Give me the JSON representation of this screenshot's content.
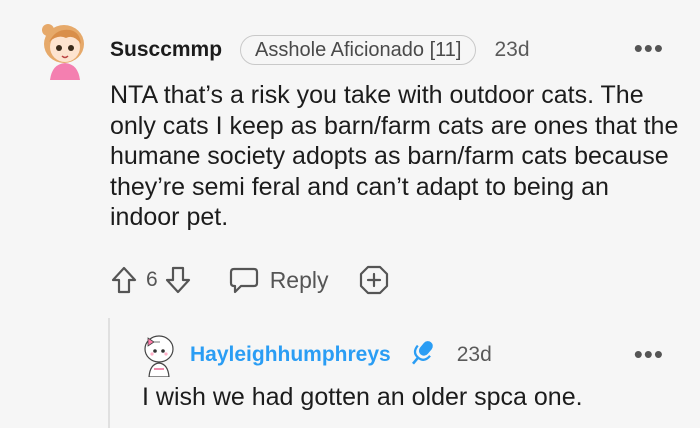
{
  "comment": {
    "username": "Susccmmp",
    "flair": "Asshole Aficionado [11]",
    "time": "23d",
    "more_icon": "more-dots-icon",
    "body": "NTA that’s a risk you take with outdoor cats. The only cats I keep as barn/farm cats are ones that the humane society adopts as barn/farm cats because they’re semi feral and can’t adapt to being an indoor pet.",
    "votes": "6",
    "reply_label": "Reply",
    "icons": {
      "upvote": "upvote-arrow-icon",
      "downvote": "downvote-arrow-icon",
      "reply": "speech-bubble-icon",
      "award": "award-plus-icon"
    }
  },
  "reply": {
    "username": "Hayleighhumphreys",
    "time": "23d",
    "body": "I wish we had gotten an older spca one.",
    "badge_icon": "microphone-icon",
    "username_color": "#2a9df4"
  }
}
